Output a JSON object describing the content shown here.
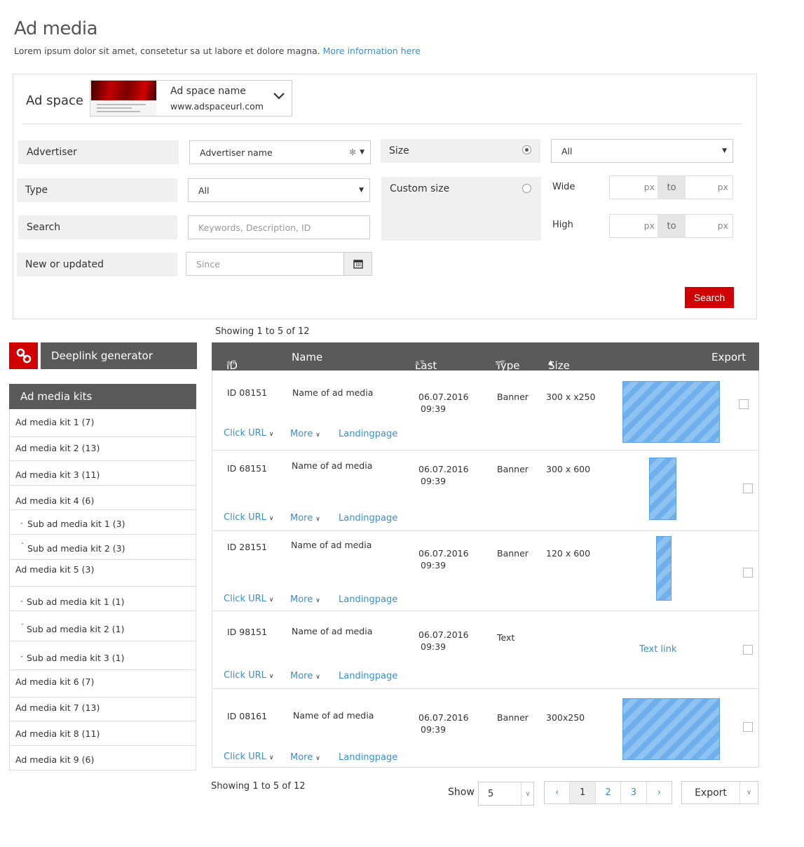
{
  "page": {
    "title": "Ad media",
    "description": "Lorem ipsum dolor sit amet, consetetur sa ut labore et dolore magna.",
    "more_info_link": "More information here"
  },
  "ad_space": {
    "label": "Ad space",
    "name": "Ad space name",
    "url": "www.adspaceurl.com"
  },
  "filters": {
    "advertiser_label": "Advertiser",
    "advertiser_value": "Advertiser name",
    "type_label": "Type",
    "type_value": "All",
    "search_label": "Search",
    "search_placeholder": "Keywords, Description, ID",
    "new_label": "New or updated",
    "since_placeholder": "Since",
    "size_label": "Size",
    "size_value": "All",
    "custom_size_label": "Custom size",
    "wide_label": "Wide",
    "high_label": "High",
    "px": "px",
    "to": "to",
    "search_button": "Search"
  },
  "showing_top": "Showing 1 to 5 of 12",
  "showing_bottom": "Showing 1 to 5 of 12",
  "deeplink": {
    "label": "Deeplink generator"
  },
  "kits": {
    "header": "Ad media kits",
    "items": [
      "Ad media kit 1 (7)",
      "Ad media kit 2 (13)",
      "Ad media kit 3 (11)",
      "Ad media kit 4 (6)",
      "Sub ad media kit 1 (3)",
      "Sub ad media kit 2 (3)",
      "Ad media kit 5 (3)",
      "Sub ad media kit 1 (1)",
      "Sub ad media kit 2 (1)",
      "Sub ad media kit 3 (1)",
      "Ad media kit 6 (7)",
      "Ad media kit 7 (13)",
      "Ad media kit 8 (11)",
      "Ad media kit 9 (6)"
    ]
  },
  "table": {
    "headers": {
      "id": "ID",
      "name": "Name",
      "last_update": "Last update",
      "type": "Type",
      "size": "Size",
      "export": "Export"
    },
    "click_url": "Click URL",
    "more": "More",
    "landingpage": "Landingpage",
    "rows": [
      {
        "id": "ID 08151",
        "name": "Name of ad media",
        "date": "06.07.2016",
        "time": "09:39",
        "type": "Banner",
        "size": "300 x x250"
      },
      {
        "id": "ID 68151",
        "name": "Name of ad media",
        "date": "06.07.2016",
        "time": "09:39",
        "type": "Banner",
        "size": "300 x 600"
      },
      {
        "id": "ID 28151",
        "name": "Name of ad media",
        "date": "06.07.2016",
        "time": "09:39",
        "type": "Banner",
        "size": "120 x 600"
      },
      {
        "id": "ID 98151",
        "name": "Name of ad media",
        "date": "06.07.2016",
        "time": "09:39",
        "type": "Text",
        "size": "",
        "text_link": "Text link"
      },
      {
        "id": "ID 08161",
        "name": "Name of ad media",
        "date": "06.07.2016",
        "time": "09:39",
        "type": "Banner",
        "size": "300x250"
      }
    ]
  },
  "footer": {
    "show_label": "Show",
    "show_value": "5",
    "pages": [
      "1",
      "2",
      "3"
    ],
    "current_page": "1",
    "export_label": "Export"
  },
  "colors": {
    "accent": "#d10000",
    "link": "#3a8fd0",
    "header_bg": "#5a5a5a"
  }
}
